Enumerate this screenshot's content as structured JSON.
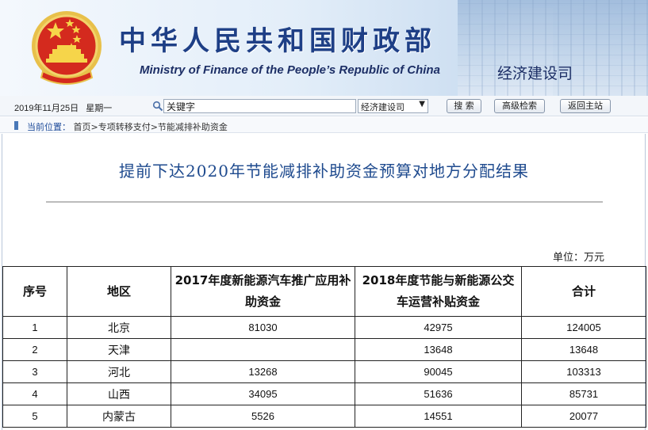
{
  "header": {
    "title_cn": "中华人民共和国财政部",
    "title_en": "Ministry of Finance of the People’s Republic of China",
    "dept": "经济建设司"
  },
  "toolbar": {
    "date": "2019年11月25日",
    "weekday": "星期一",
    "search_value": "关键字",
    "scope_selected": "经济建设司",
    "search_button": "搜 索",
    "advanced_button": "高级检索",
    "home_button": "返回主站"
  },
  "breadcrumb": {
    "label": "当前位置：",
    "path": "首页>专项转移支付>节能减排补助资金"
  },
  "article": {
    "title": "提前下达2020年节能减排补助资金预算对地方分配结果",
    "unit": "单位：万元"
  },
  "table": {
    "headers": [
      "序号",
      "地区",
      "2017年度新能源汽车推广应用补助资金",
      "2018年度节能与新能源公交车运营补贴资金",
      "合计"
    ],
    "rows": [
      {
        "no": "1",
        "region": "北京",
        "a": "81030",
        "b": "42975",
        "total": "124005"
      },
      {
        "no": "2",
        "region": "天津",
        "a": "",
        "b": "13648",
        "total": "13648"
      },
      {
        "no": "3",
        "region": "河北",
        "a": "13268",
        "b": "90045",
        "total": "103313"
      },
      {
        "no": "4",
        "region": "山西",
        "a": "34095",
        "b": "51636",
        "total": "85731"
      },
      {
        "no": "5",
        "region": "内蒙古",
        "a": "5526",
        "b": "14551",
        "total": "20077"
      }
    ]
  },
  "colors": {
    "brand_blue": "#1e3f86",
    "title_blue": "#1e4a8e",
    "emblem_red": "#d42a1e",
    "emblem_gold": "#e8c04a"
  }
}
